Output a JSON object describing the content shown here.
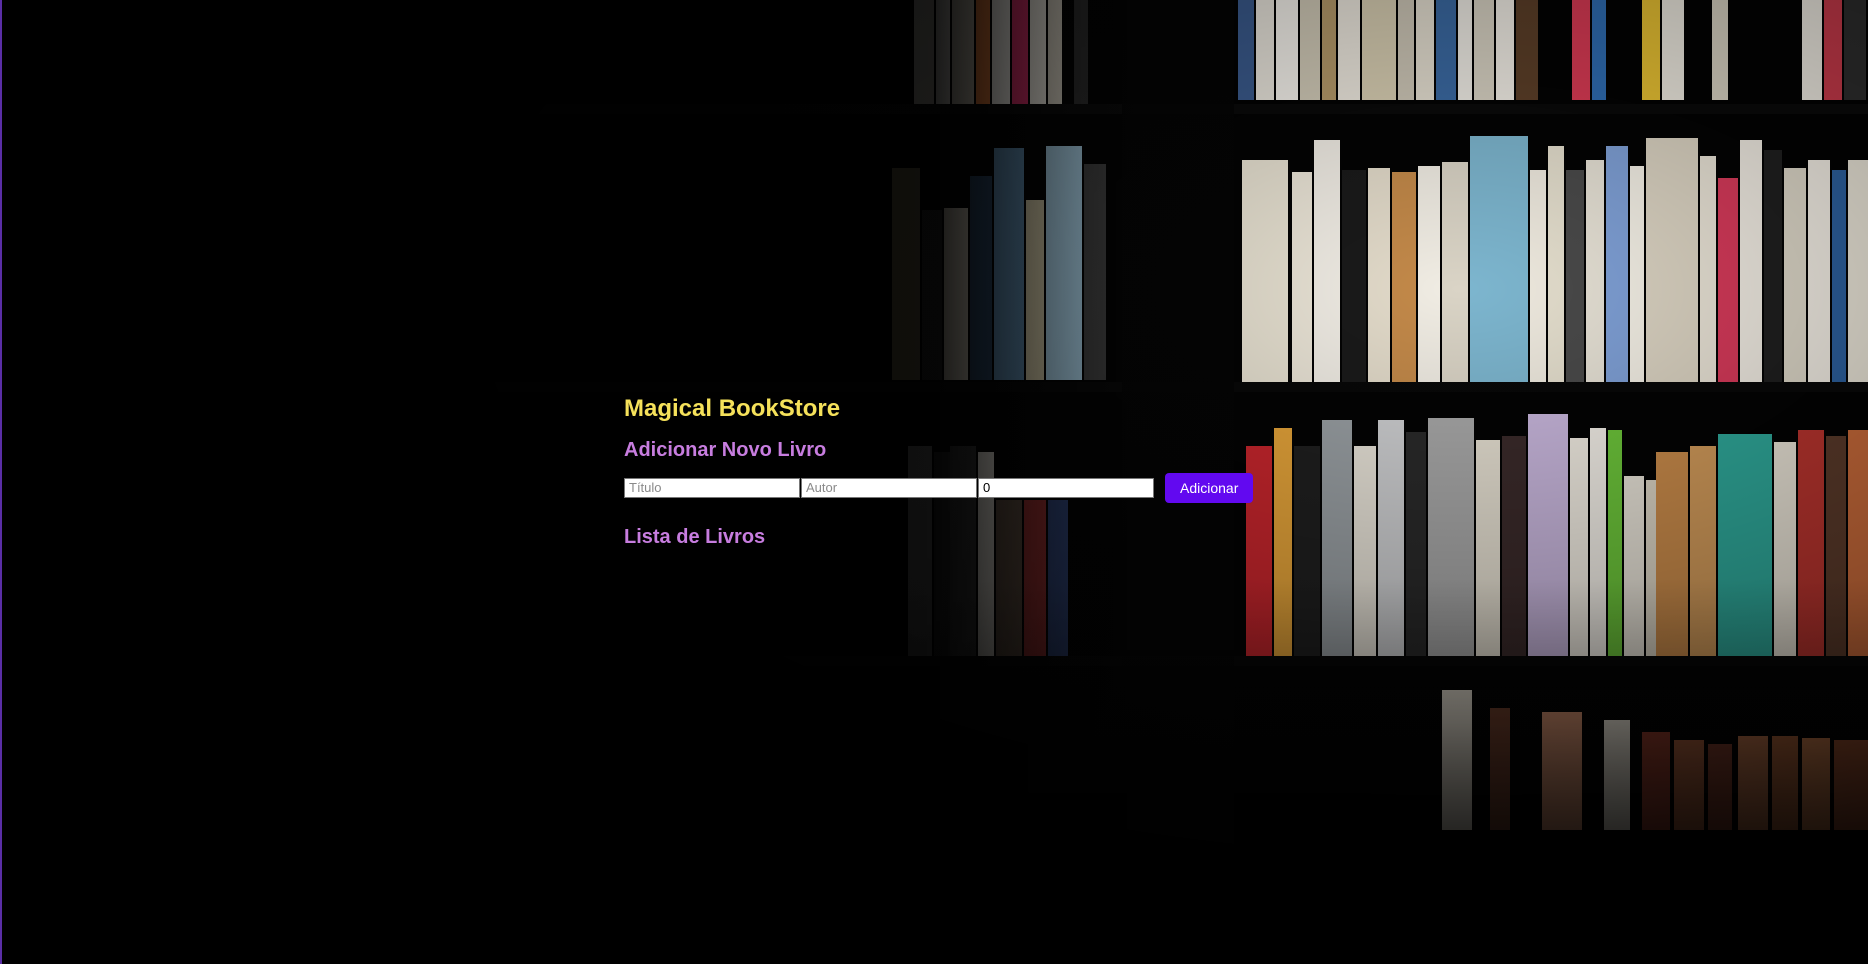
{
  "app": {
    "title": "Magical BookStore"
  },
  "add_section": {
    "heading": "Adicionar Novo Livro",
    "fields": {
      "title_placeholder": "Título",
      "title_value": "",
      "author_placeholder": "Autor",
      "author_value": "",
      "price_value": "0"
    },
    "submit_label": "Adicionar"
  },
  "list_section": {
    "heading": "Lista de Livros",
    "items": []
  },
  "colors": {
    "title": "#f5e15a",
    "heading": "#c77ddf",
    "button": "#6209f0",
    "background": "#020202"
  },
  "background_image": {
    "icon": "bookshelf-photo"
  }
}
